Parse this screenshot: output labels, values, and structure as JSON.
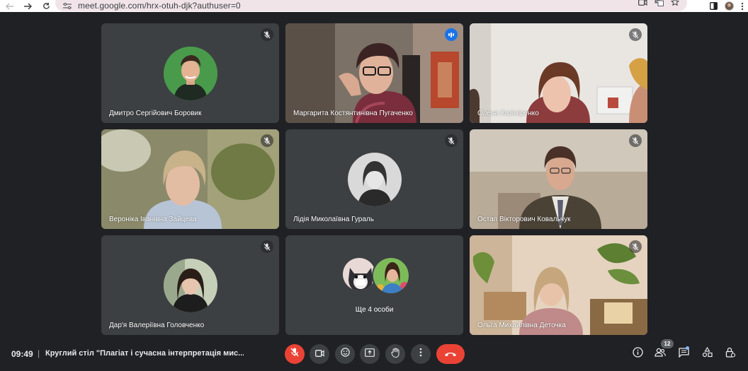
{
  "browser": {
    "url": "meet.google.com/hrx-otuh-djk?authuser=0",
    "icons": [
      "back-icon",
      "forward-icon",
      "reload-icon",
      "site-settings-icon",
      "camera-icon",
      "translate-icon",
      "star-icon",
      "sidebar-icon",
      "profile-avatar",
      "menu-icon"
    ]
  },
  "tiles": [
    {
      "name": "Дмитро Сергійович Боровик",
      "muted": true,
      "video": false
    },
    {
      "name": "Маргарита Костянтинівна Пугаченко",
      "muted": false,
      "speaking": true,
      "video": true
    },
    {
      "name": "Олена Казіміренко",
      "muted": true,
      "video": true
    },
    {
      "name": "Вероніка Іванівна Зайцева",
      "muted": true,
      "video": true
    },
    {
      "name": "Лідія Миколаївна Гураль",
      "muted": true,
      "video": false
    },
    {
      "name": "Остап Вікторович Ковальчук",
      "muted": true,
      "video": true
    },
    {
      "name": "Дар'я Валеріївна Головченко",
      "muted": true,
      "video": false
    },
    {
      "name": "Ще 4 особи",
      "overflow": true
    },
    {
      "name": "Ольга Михайлівна Деточка",
      "muted": true,
      "video": true
    }
  ],
  "bottom_bar": {
    "time": "09:49",
    "separator": "|",
    "meeting_title": "Круглий стіл \"Плагіат і сучасна інтерпретація мис...",
    "controls": [
      "mic-off-icon",
      "camera-icon",
      "emoji-icon",
      "present-icon",
      "raise-hand-icon",
      "more-options-icon",
      "end-call-icon"
    ],
    "side_controls": [
      "info-icon",
      "people-icon",
      "chat-icon",
      "activities-icon",
      "host-controls-icon"
    ],
    "people_count": "12"
  },
  "colors": {
    "background": "#202124",
    "tile": "#3c4043",
    "accent": "#8ab4f8",
    "danger": "#ea4335"
  }
}
